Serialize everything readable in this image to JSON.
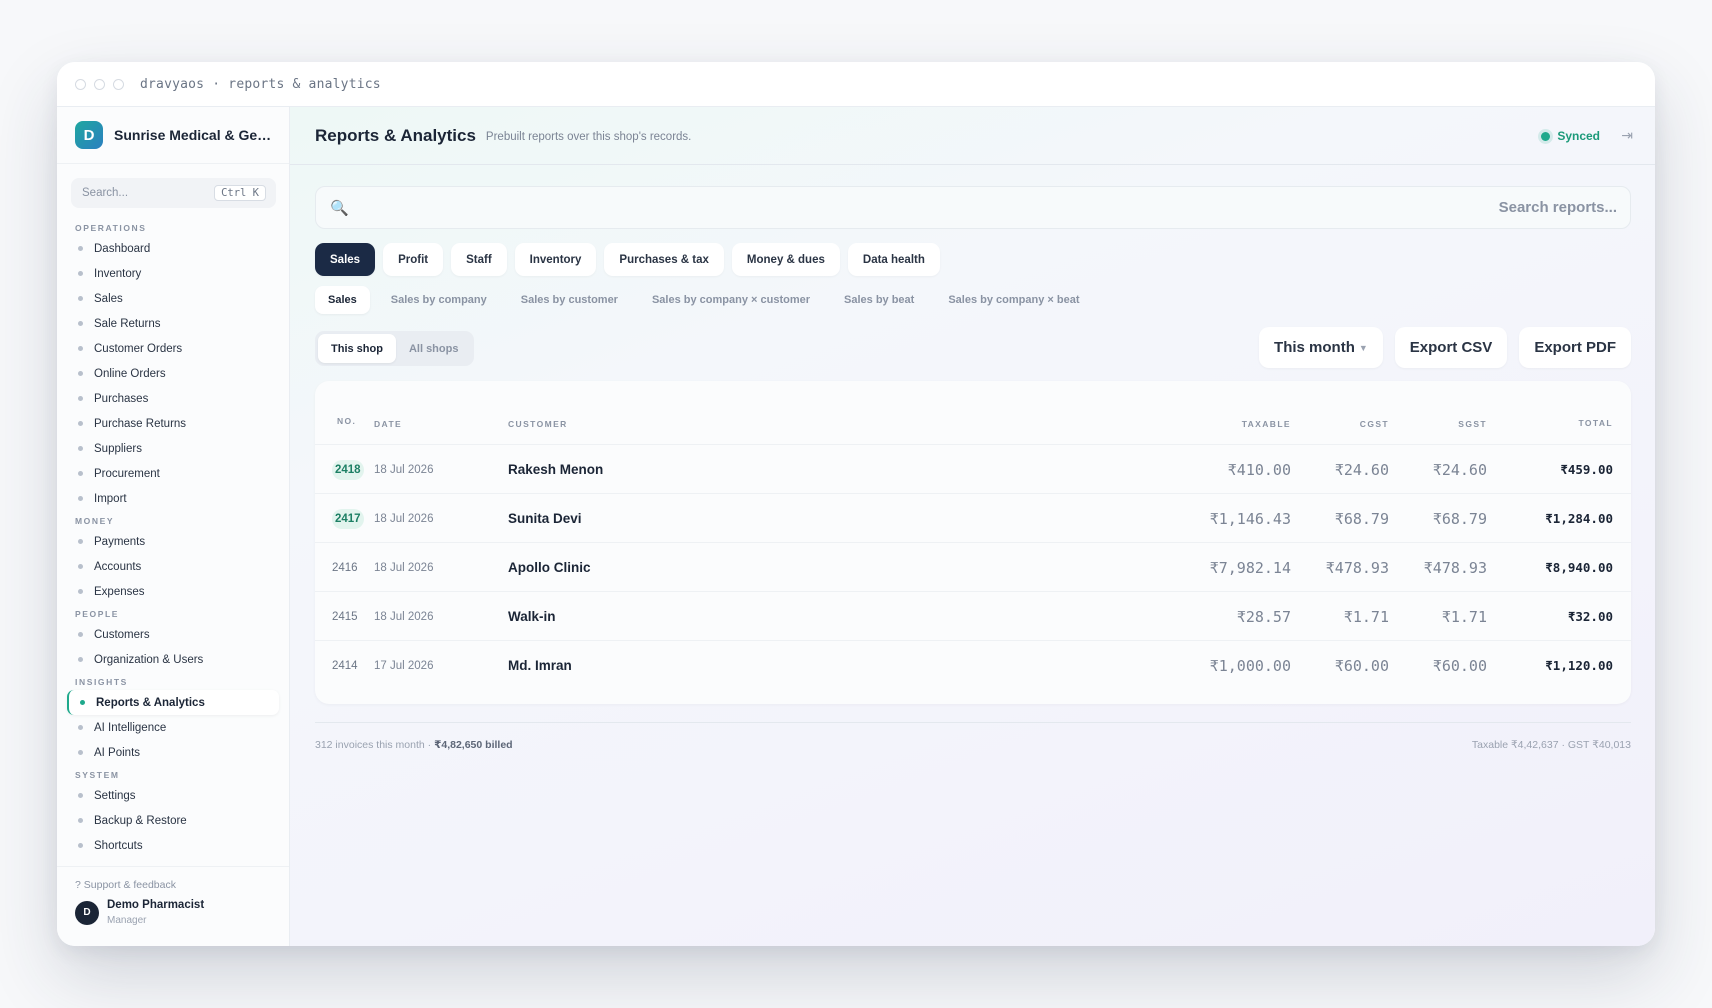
{
  "window": {
    "title": "dravyaos · reports & analytics"
  },
  "sidebar": {
    "brand_initial": "D",
    "brand_name": "Sunrise Medical & General Store",
    "search_placeholder": "Search...",
    "search_shortcut": "Ctrl K",
    "sections": [
      {
        "label": "OPERATIONS",
        "items": [
          "Dashboard",
          "Inventory",
          "Sales",
          "Sale Returns",
          "Customer Orders",
          "Online Orders",
          "Purchases",
          "Purchase Returns",
          "Suppliers",
          "Procurement",
          "Import"
        ]
      },
      {
        "label": "MONEY",
        "items": [
          "Payments",
          "Accounts",
          "Expenses"
        ]
      },
      {
        "label": "PEOPLE",
        "items": [
          "Customers",
          "Organization & Users"
        ]
      },
      {
        "label": "INSIGHTS",
        "items": [
          "Reports & Analytics",
          "AI Intelligence",
          "AI Points"
        ]
      },
      {
        "label": "SYSTEM",
        "items": [
          "Settings",
          "Backup & Restore",
          "Shortcuts"
        ]
      }
    ],
    "active_item": "Reports & Analytics",
    "support": "? Support & feedback",
    "user": {
      "initial": "D",
      "name": "Demo Pharmacist",
      "role": "Manager"
    }
  },
  "header": {
    "title": "Reports & Analytics",
    "subtitle": "Prebuilt reports over this shop's records.",
    "status": "Synced",
    "accent": "#1fa98c"
  },
  "report_search": {
    "placeholder": "Search reports..."
  },
  "tabs": [
    "Sales",
    "Profit",
    "Staff",
    "Inventory",
    "Purchases & tax",
    "Money & dues",
    "Data health"
  ],
  "active_tab": "Sales",
  "subtabs": [
    "Sales",
    "Sales by company",
    "Sales by customer",
    "Sales by company × customer",
    "Sales by beat",
    "Sales by company × beat"
  ],
  "active_subtab": "Sales",
  "scope": {
    "items": [
      "This shop",
      "All shops"
    ],
    "active": "This shop"
  },
  "actions": {
    "period": "This month",
    "export_csv": "Export CSV",
    "export_pdf": "Export PDF"
  },
  "table": {
    "columns": {
      "no": "NO.",
      "date": "DATE",
      "customer": "CUSTOMER",
      "taxable": "TAXABLE",
      "cgst": "CGST",
      "sgst": "SGST",
      "total": "TOTAL"
    },
    "rows": [
      {
        "no": "2418",
        "date": "18 Jul 2026",
        "customer": "Rakesh Menon",
        "taxable": "₹410.00",
        "cgst": "₹24.60",
        "sgst": "₹24.60",
        "total": "₹459.00",
        "highlight": true
      },
      {
        "no": "2417",
        "date": "18 Jul 2026",
        "customer": "Sunita Devi",
        "taxable": "₹1,146.43",
        "cgst": "₹68.79",
        "sgst": "₹68.79",
        "total": "₹1,284.00",
        "highlight": true
      },
      {
        "no": "2416",
        "date": "18 Jul 2026",
        "customer": "Apollo Clinic",
        "taxable": "₹7,982.14",
        "cgst": "₹478.93",
        "sgst": "₹478.93",
        "total": "₹8,940.00",
        "highlight": false
      },
      {
        "no": "2415",
        "date": "18 Jul 2026",
        "customer": "Walk-in",
        "taxable": "₹28.57",
        "cgst": "₹1.71",
        "sgst": "₹1.71",
        "total": "₹32.00",
        "highlight": false
      },
      {
        "no": "2414",
        "date": "17 Jul 2026",
        "customer": "Md. Imran",
        "taxable": "₹1,000.00",
        "cgst": "₹60.00",
        "sgst": "₹60.00",
        "total": "₹1,120.00",
        "highlight": false
      }
    ]
  },
  "footer": {
    "summary_prefix": "312 invoices this month · ",
    "summary_bold": "₹4,82,650 billed",
    "tax_summary": "Taxable ₹4,42,637 · GST ₹40,013"
  }
}
